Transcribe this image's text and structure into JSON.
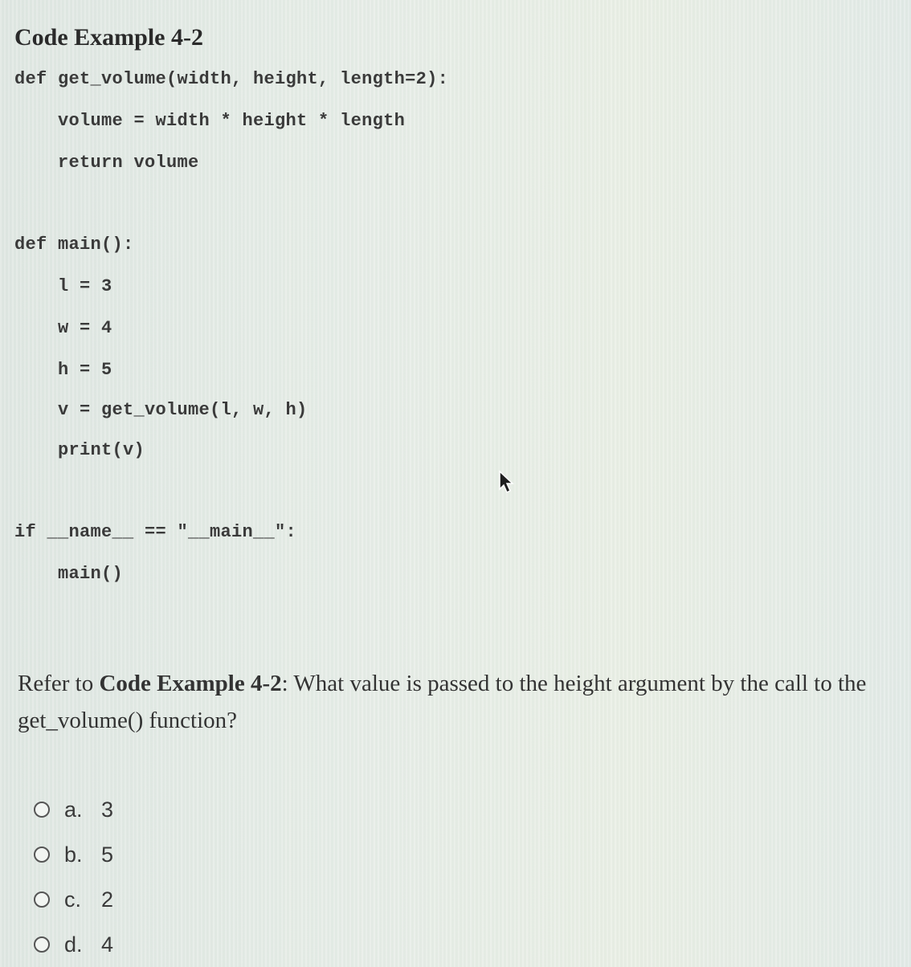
{
  "title": "Code Example 4-2",
  "code": {
    "lines": [
      "def get_volume(width, height, length=2):",
      "    volume = width * height * length",
      "    return volume",
      "def main():",
      "    l = 3",
      "    w = 4",
      "    h = 5",
      "    v = get_volume(l, w, h)",
      "    print(v)",
      "if __name__ == \"__main__\":",
      "    main()"
    ]
  },
  "question": {
    "prefix": "Refer to ",
    "bold": "Code Example 4-2",
    "suffix": ": What value is passed to the height argument by the call to the get_volume() function?"
  },
  "options": [
    {
      "letter": "a.",
      "value": "3"
    },
    {
      "letter": "b.",
      "value": "5"
    },
    {
      "letter": "c.",
      "value": "2"
    },
    {
      "letter": "d.",
      "value": "4"
    }
  ],
  "cursor": {
    "icon": "mouse-pointer-icon"
  }
}
